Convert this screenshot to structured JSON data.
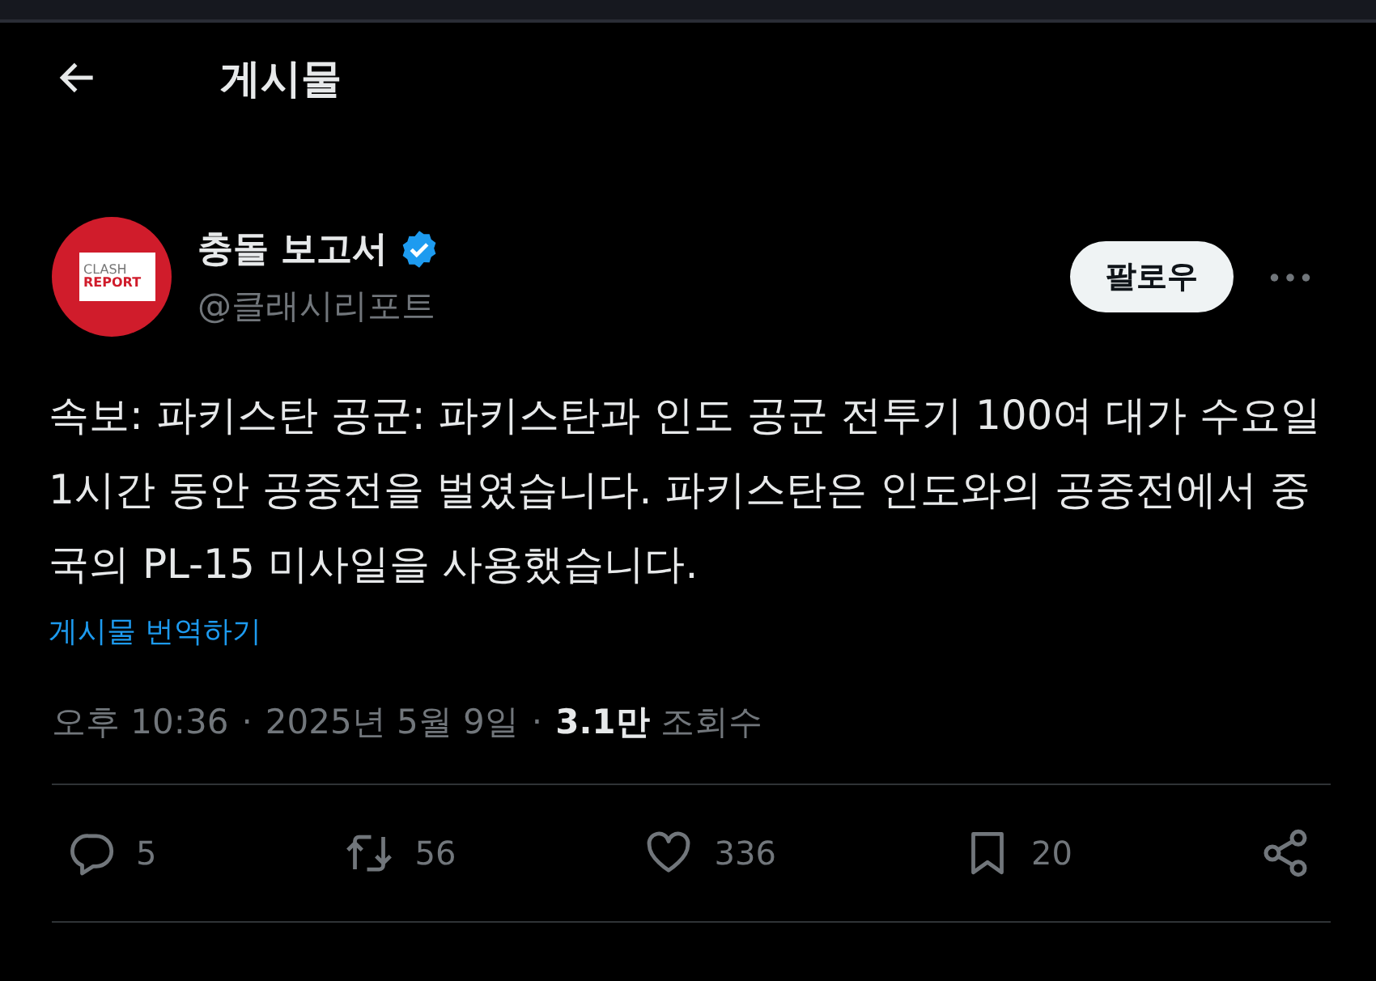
{
  "header": {
    "title": "게시물"
  },
  "author": {
    "name": "충돌 보고서",
    "verified": true,
    "handle": "@클래시리포트",
    "logo_lines": [
      "CLASH",
      "REPORT"
    ]
  },
  "follow_button": "팔로우",
  "post": {
    "text": "속보: 파키스탄 공군: 파키스탄과 인도 공군 전투기 100여 대가 수요일 1시간 동안 공중전을 벌였습니다. 파키스탄은 인도와의 공중전에서 중국의 PL-15 미사일을 사용했습니다.",
    "translate_link": "게시물 번역하기"
  },
  "meta": {
    "time": "오후 10:36",
    "separator": "·",
    "date": "2025년 5월 9일",
    "views": "**3.1만** 조회수"
  },
  "actions": [
    {
      "kind": "reply",
      "count": "5"
    },
    {
      "kind": "repost",
      "count": "56"
    },
    {
      "kind": "like",
      "count": "336"
    },
    {
      "kind": "bookmark",
      "count": "20"
    },
    {
      "kind": "share"
    }
  ]
}
